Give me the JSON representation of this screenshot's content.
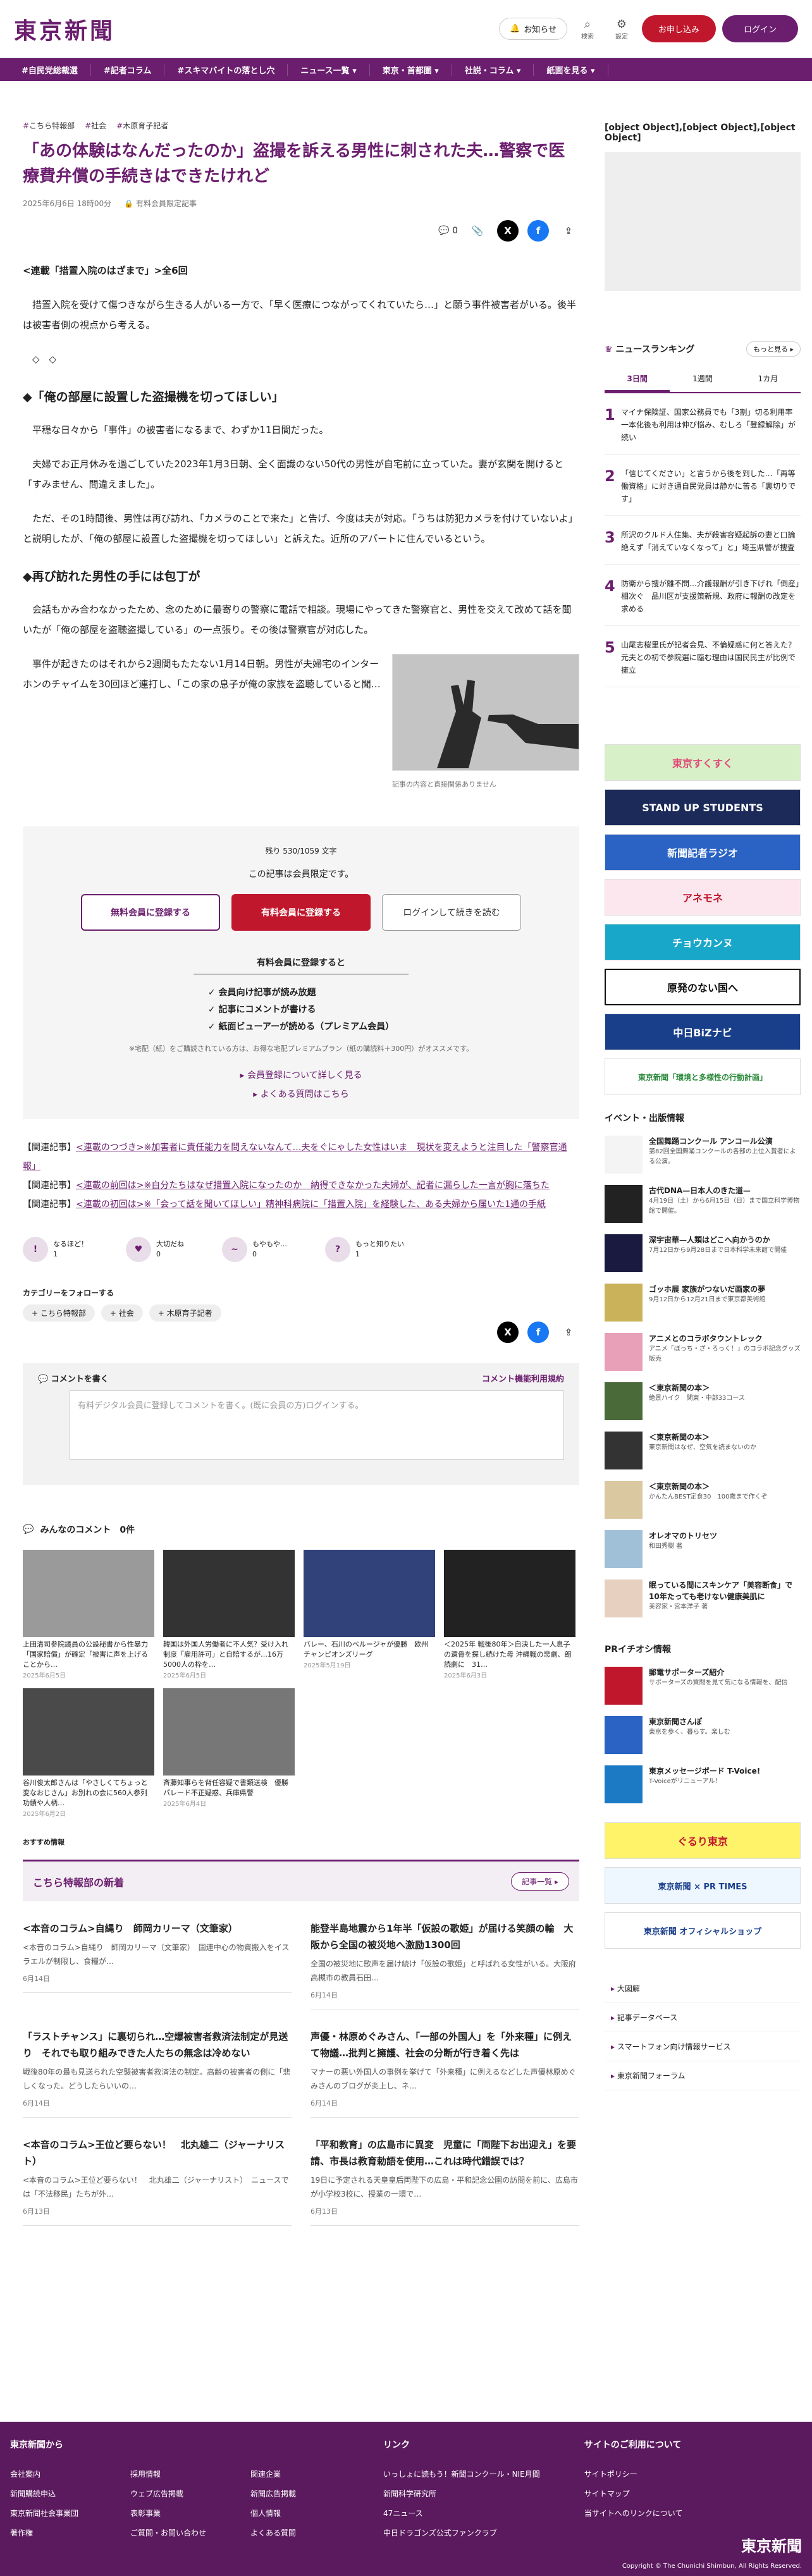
{
  "header": {
    "logo": "東京新聞",
    "bell": "お知らせ",
    "search": "検索",
    "settings": "設定",
    "subscribe": "お申し込み",
    "login": "ログイン"
  },
  "nav": [
    "#自民党総裁選",
    "#記者コラム",
    "#スキマバイトの落とし穴",
    "ニュース一覧 ▾",
    "東京・首都圏 ▾",
    "社説・コラム ▾",
    "紙面を見る ▾"
  ],
  "article": {
    "tags": [
      "こちら特報部",
      "社会",
      "木原育子記者"
    ],
    "title": "「あの体験はなんだったのか」盗撮を訴える男性に刺された夫…警察で医療費弁償の手続きはできたけれど",
    "date": "2025年6月6日 18時00分",
    "premium": "有料会員限定記事",
    "comment_count": "0",
    "series": "<連載「措置入院のはざまで」>全6回",
    "p1": "措置入院を受けて傷つきながら生きる人がいる一方で、「早く医療につながってくれていたら…」と願う事件被害者がいる。後半は被害者側の視点から考える。",
    "dots": "◇　◇",
    "h1": "◆「俺の部屋に設置した盗撮機を切ってほしい」",
    "p2": "平穏な日々から「事件」の被害者になるまで、わずか11日間だった。",
    "p3": "夫婦でお正月休みを過ごしていた2023年1月3日朝、全く面識のない50代の男性が自宅前に立っていた。妻が玄関を開けると「すみません、間違えました」。",
    "p4": "ただ、その1時間後、男性は再び訪れ、「カメラのことで来た」と告げ、今度は夫が対応。「うちは防犯カメラを付けていないよ」と説明したが、「俺の部屋に設置した盗撮機を切ってほしい」と訴えた。近所のアパートに住んでいるという。",
    "h2": "◆再び訪れた男性の手には包丁が",
    "p5": "会話もかみ合わなかったため、念のために最寄りの警察に電話で相談。現場にやってきた警察官と、男性を交えて改めて話を聞いたが「俺の部屋を盗聴盗撮している」の一点張り。その後は警察官が対応した。",
    "p6": "事件が起きたのはそれから2週間もたたない1月14日朝。男性が夫婦宅のインターホンのチャイムを30回ほど連打し、「この家の息子が俺の家族を盗聴していると聞…",
    "caption": "記事の内容と直接関係ありません"
  },
  "paywall": {
    "remaining": "残り 530/1059 文字",
    "only": "この記事は会員限定です。",
    "free": "無料会員に登録する",
    "paid": "有料会員に登録する",
    "login": "ログインして続きを読む",
    "benefit_head": "有料会員に登録すると",
    "benefits": [
      "会員向け記事が読み放題",
      "記事にコメントが書ける",
      "紙面ビューアーが読める（プレミアム会員）"
    ],
    "note": "※宅配（紙）をご購読されている方は、お得な宅配プレミアムプラン（紙の購読料＋300円）がオススメです。",
    "more": "▸ 会員登録について詳しく見る",
    "faq": "▸ よくある質問はこちら"
  },
  "related": [
    {
      "label": "【関連記事】",
      "text": "<連載のつづき>※加害者に責任能力を問えないなんて…夫をぐにゃした女性はいま　現状を変えようと注目した「警察官通報」"
    },
    {
      "label": "【関連記事】",
      "text": "<連載の前回は>※自分たちはなぜ措置入院になったのか　納得できなかった夫婦が、記者に漏らした一言が胸に落ちた"
    },
    {
      "label": "【関連記事】",
      "text": "<連載の初回は>※「会って話を聞いてほしい」精神科病院に「措置入院」を経験した、ある夫婦から届いた1通の手紙"
    }
  ],
  "reactions": [
    {
      "label": "なるほど！",
      "n": "1",
      "g": "!"
    },
    {
      "label": "大切だね",
      "n": "0",
      "g": "♥"
    },
    {
      "label": "もやもや…",
      "n": "0",
      "g": "~"
    },
    {
      "label": "もっと知りたい",
      "n": "1",
      "g": "?"
    }
  ],
  "follow": {
    "head": "カテゴリーをフォローする",
    "chips": [
      "+ こちら特報部",
      "+ 社会",
      "+ 木原育子記者"
    ]
  },
  "comment": {
    "head": "コメントを書く",
    "policy": "コメント機能利用規約",
    "placeholder": "有料デジタル会員に登録してコメントを書く。(既に会員の方)ログインする。"
  },
  "comments_head": "みんなのコメント　0件",
  "grid": [
    {
      "t": "上田清司参院議員の公設秘書から性暴力「国家賠償」が確定「被害に声を上げることから…",
      "d": "2025年6月5日"
    },
    {
      "t": "韓国は外国人労働者に不人気？受け入れ制度「雇用許可」と自賠するが…16万5000人の枠を…",
      "d": "2025年6月5日"
    },
    {
      "t": "バレー、石川のベルージャが優勝　欧州チャンピオンズリーグ",
      "d": "2025年5月19日"
    },
    {
      "t": "＜2025年 戦後80年＞自決した一人息子の遺骨を探し続けた母 沖縄戦の悲劇、朗読劇に　31…",
      "d": "2025年6月3日"
    },
    {
      "t": "谷川俊太郎さんは「やさしくてちょっと変なおじさん」お別れの会に560人参列　功績や人柄…",
      "d": "2025年6月2日"
    },
    {
      "t": "斉藤知事らを背任容疑で書類送検　優勝パレード不正疑惑、兵庫県警",
      "d": "2025年6月4日"
    }
  ],
  "rec": "おすすめ情報",
  "section": {
    "title": "こちら特報部の新着",
    "more": "記事一覧 ▸"
  },
  "articles": [
    {
      "t": "<本音のコラム>自縄り　師岡カリーマ（文筆家）",
      "b": "<本音のコラム>自縄り　師岡カリーマ（文筆家）　国連中心の物資搬入をイスラエルが制限し、食糧が…",
      "d": "6月14日"
    },
    {
      "t": "能登半島地震から1年半「仮設の歌姫」が届ける笑顔の輪　大阪から全国の被災地へ激励1300回",
      "b": "全国の被災地に歌声を届け続け「仮設の歌姫」と呼ばれる女性がいる。大阪府高槻市の教員石田…",
      "d": "6月14日"
    },
    {
      "t": "「ラストチャンス」に裏切られ…空爆被害者救済法制定が見送り　それでも取り組みできた人たちの無念は冷めない",
      "b": "戦後80年の最も見送られた空襲被害者救済法の制定。高齢の被害者の側に「悲しくなった。どうしたらいいの…",
      "d": "6月14日"
    },
    {
      "t": "声優・林原めぐみさん、「一部の外国人」を「外来種」に例えて物議…批判と擁護、社会の分断が行き着く先は",
      "b": "マナーの悪い外国人の事例を挙げて「外来種」に例えるなどした声優林原めぐみさんのブログが炎上し、ネ…",
      "d": "6月14日"
    },
    {
      "t": "<本音のコラム>王位ど要らない！　北丸雄二（ジャーナリスト）",
      "b": "<本音のコラム>王位ど要らない！　北丸雄二（ジャーナリスト）　ニュースでは「不法移民」たちが外…",
      "d": "6月13日"
    },
    {
      "t": "「平和教育」の広島市に異変　児童に「両陛下お出迎え」を要請、市長は教育勅語を使用…これは時代錯誤では？",
      "b": "19日に予定される天皇皇后両陛下の広島・平和記念公園の訪問を前に、広島市が小学校3校に、授業の一環で…",
      "d": "6月13日"
    }
  ],
  "side": {
    "pr": [
      {
        "t": "郵電サポーターズ紹介",
        "d": "サポーターズの質問を見て気になる情報を、配信"
      },
      {
        "t": "東京新聞さんぽ",
        "d": "東京を歩く、暮らす。楽しむ"
      },
      {
        "t": "東京メッセージボード T-Voice!",
        "d": "T-Voiceがリニューアル！"
      }
    ],
    "ranking": "ニュースランキング",
    "more": "もっと見る ▸",
    "tabs": [
      "3日間",
      "1週間",
      "1カ月"
    ],
    "ranks": [
      "マイナ保険証、国家公務員でも「3割」切る利用率　一本化後も利用は伸び悩み、むしろ「登録解除」が続い",
      "「信じてください」と言うから後を到した…「再等働資格」に対き通自民党員は静かに苦る「裏切りです」",
      "所沢のクルド人住集、夫が殺害容疑起訴の妻と口論絶えず「消えていなくなって」と」埼玉県警が捜査",
      "防衛から捜が離不問…介護報酬が引き下げれ「倒産」相次ぐ　品川区が支援策新規、政府に報酬の改定を求める",
      "山尾志桜里氏が記者会見、不倫疑惑に何と答えた？　元夫との初で参院選に臨む理由は国民民主が比例で擁立"
    ],
    "banners": [
      "東京すくすく",
      "STAND UP STUDENTS",
      "新聞記者ラジオ",
      "アネモネ",
      "チョウカンヌ",
      "原発のない国へ",
      "中日BiZナビ",
      "東京新聞「環境と多様性の行動計画」"
    ],
    "events_head": "イベント・出版情報",
    "events": [
      {
        "t": "全国舞踊コンクール アンコール公演",
        "d": "第82回全国舞踊コンクールの各部の上位入賞者による公演。"
      },
      {
        "t": "古代DNA—日本人のきた道—",
        "d": "4月19日（土）から6月15日（日）まで国立科学博物館で開催。"
      },
      {
        "t": "深宇宙華—人類はどこへ向かうのか",
        "d": "7月12日から9月28日まで日本科学未来館で開催"
      },
      {
        "t": "ゴッホ展 家族がつないだ画家の夢",
        "d": "9月12日から12月21日まで東京都美術館"
      },
      {
        "t": "アニメとのコラボタウントレック",
        "d": "アニメ「ぼっち・ざ・ろっく！」のコラボ記念グッズ販売"
      },
      {
        "t": "＜東京新聞の本＞",
        "d": "絶景ハイク　関東・中部33コース"
      },
      {
        "t": "＜東京新聞の本＞",
        "d": "東京新聞はなぜ、空気を読まないのか"
      },
      {
        "t": "＜東京新聞の本＞",
        "d": "かんたんBEST定食30　100歳まで作くぞ"
      },
      {
        "t": "オレオマのトリセツ",
        "d": "和田秀樹 著"
      },
      {
        "t": "眠っている間にスキンケア「美容断食」で10年たっても老けない健康美肌に",
        "d": "美容家・宮本洋子 著"
      }
    ],
    "pr_head": "PRイチオシ情報",
    "sbanners": [
      "ぐるり東京",
      "東京新聞 × PR TIMES",
      "東京新聞 オフィシャルショップ"
    ],
    "links": [
      "大図解",
      "記事データベース",
      "スマートフォン向け情報サービス",
      "東京新聞フォーラム"
    ]
  },
  "footer": {
    "c1": "東京新聞から",
    "c1l": [
      "会社案内",
      "採用情報",
      "関連企業",
      "新聞購読申込",
      "ウェブ広告掲載",
      "新聞広告掲載",
      "東京新聞社会事業団",
      "表彰事業",
      "個人情報",
      "著作権",
      "ご質問・お問い合わせ",
      "よくある質問"
    ],
    "c2": "リンク",
    "c2l": [
      "いっしょに読もう！新聞コンクール・NIE月間",
      "新聞科学研究所",
      "47ニュース",
      "中日ドラゴンズ公式ファンクラブ"
    ],
    "c3": "サイトのご利用について",
    "c3l": [
      "サイトポリシー",
      "サイトマップ",
      "当サイトへのリンクについて"
    ],
    "logo": "東京新聞",
    "copy": "Copyright © The Chunichi Shimbun, All Rights Reserved."
  }
}
